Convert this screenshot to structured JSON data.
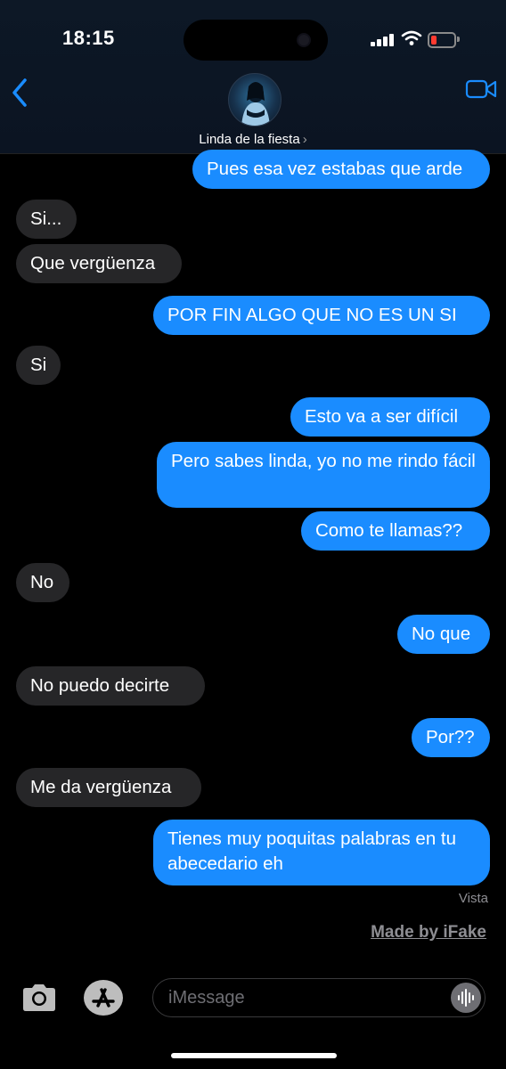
{
  "status": {
    "time": "18:15"
  },
  "header": {
    "contact_name": "Linda de la fiesta",
    "chevron": "›"
  },
  "messages": [
    {
      "from": "me",
      "text": "Pues esa vez estabas que arde"
    },
    {
      "from": "them",
      "text": "Si..."
    },
    {
      "from": "them",
      "text": "Que vergüenza"
    },
    {
      "from": "me",
      "text": "POR FIN ALGO QUE NO ES UN SI"
    },
    {
      "from": "them",
      "text": "Si"
    },
    {
      "from": "me",
      "text": "Esto va a ser difícil"
    },
    {
      "from": "me",
      "text": "Pero sabes linda, yo no me rindo fácil"
    },
    {
      "from": "me",
      "text": "Como te llamas??"
    },
    {
      "from": "them",
      "text": "No"
    },
    {
      "from": "me",
      "text": "No que"
    },
    {
      "from": "them",
      "text": "No puedo decirte"
    },
    {
      "from": "me",
      "text": "Por??"
    },
    {
      "from": "them",
      "text": "Me da vergüenza"
    },
    {
      "from": "me",
      "text": "Tienes muy poquitas palabras en tu abecedario eh"
    }
  ],
  "read_receipt": "Vista",
  "watermark": "Made by iFake",
  "composer": {
    "placeholder": "iMessage"
  },
  "icons": [
    "back-chevron-icon",
    "video-call-icon",
    "camera-icon",
    "app-store-icon",
    "audio-waveform-icon",
    "wifi-icon",
    "signal-icon",
    "battery-icon"
  ],
  "colors": {
    "outgoing": "#1a8cff",
    "incoming": "#262628",
    "accent": "#1a8cff",
    "battery_low": "#ff3b30"
  }
}
